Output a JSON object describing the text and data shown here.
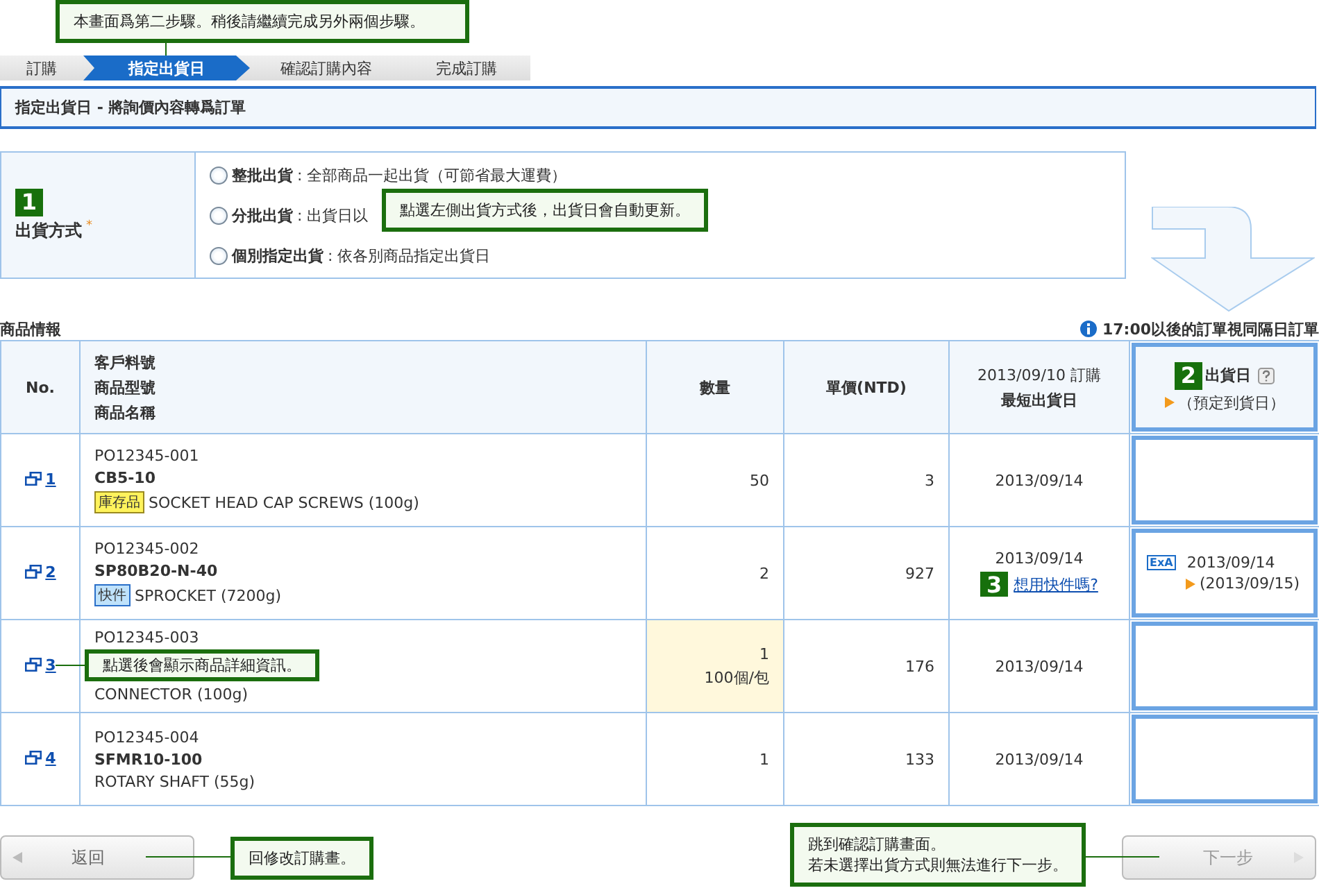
{
  "step_note": "本畫面爲第二步驟。稍後請繼續完成另外兩個步驟。",
  "steps": [
    {
      "label": "訂購",
      "selected": false
    },
    {
      "label": "指定出貨日",
      "selected": true
    },
    {
      "label": "確認訂購內容",
      "selected": false
    },
    {
      "label": "完成訂購",
      "selected": false
    }
  ],
  "page_title": "指定出貨日 - 將詢價內容轉爲訂單",
  "shipping": {
    "badge": "1",
    "label": "出貨方式",
    "required_mark": "*",
    "note": "點選左側出貨方式後，出貨日會自動更新。",
    "options": [
      {
        "name": "整批出貨",
        "desc": ": 全部商品一起出貨（可節省最大運費）",
        "selected": false
      },
      {
        "name": "分批出貨",
        "desc": ": 出貨日以",
        "selected": false
      },
      {
        "name": "個別指定出貨",
        "desc": ": 依各別商品指定出貨日",
        "selected": false
      }
    ]
  },
  "products": {
    "title": "商品情報",
    "notice": "17:00以後的訂單視同隔日訂單",
    "columns": {
      "no": "No.",
      "item": [
        "客戶料號",
        "商品型號",
        "商品名稱"
      ],
      "qty": "數量",
      "price": "單價(NTD)",
      "earliest": {
        "sub": "2013/09/10 訂購",
        "label": "最短出貨日"
      },
      "ship": {
        "badge": "2",
        "label": "出貨日",
        "sub": "（預定到貨日）"
      }
    },
    "rows": [
      {
        "no": "1",
        "po": "PO12345-001",
        "part": "CB5-10",
        "tag": {
          "text": "庫存品",
          "kind": "stock"
        },
        "name": "SOCKET HEAD CAP SCREWS (100g)",
        "qty": "50",
        "qty_highlighted": false,
        "price": "3",
        "earliest": "2013/09/14"
      },
      {
        "no": "2",
        "po": "PO12345-002",
        "part": "SP80B20-N-40",
        "tag": {
          "text": "快件",
          "kind": "express"
        },
        "name": "SPROCKET (7200g)",
        "qty": "2",
        "qty_highlighted": false,
        "price": "927",
        "earliest": "2013/09/14",
        "express": {
          "badge": "3",
          "link": "想用快件嗎?"
        },
        "ship": {
          "icon_text": "ExA",
          "date": "2013/09/14",
          "arrival": "(2013/09/15)"
        }
      },
      {
        "no": "3",
        "po": "PO12345-003",
        "name": "CONNECTOR (100g)",
        "qty": "1",
        "qty_note": "100個/包",
        "qty_highlighted": true,
        "price": "176",
        "earliest": "2013/09/14",
        "note": "點選後會顯示商品詳細資訊。"
      },
      {
        "no": "4",
        "po": "PO12345-004",
        "part": "SFMR10-100",
        "name": "ROTARY SHAFT (55g)",
        "qty": "1",
        "qty_highlighted": false,
        "price": "133",
        "earliest": "2013/09/14"
      }
    ]
  },
  "back": {
    "label": "返回",
    "note": "回修改訂購畫。",
    "disabled": false
  },
  "next": {
    "label": "下一步",
    "note": [
      "跳到確認訂購畫面。",
      "若未選擇出貨方式則無法進行下一步。"
    ],
    "disabled": true
  }
}
